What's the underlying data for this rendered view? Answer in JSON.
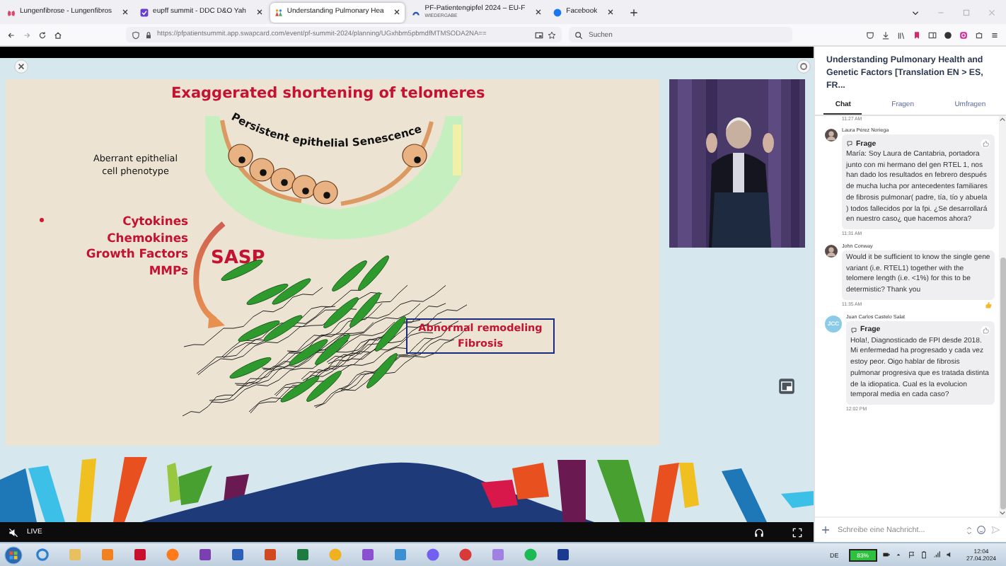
{
  "browser": {
    "tabs": [
      {
        "title": "Lungenfibrose - Lungenfibros",
        "selected": false,
        "kind": "lungs"
      },
      {
        "title": "eupff summit - DDC D&O Yah",
        "selected": false,
        "kind": "check"
      },
      {
        "title": "Understanding Pulmonary Hea",
        "selected": true,
        "kind": "people"
      },
      {
        "title": "PF-Patientengipfel 2024 – EU-F",
        "subtitle": "WIEDERGABE",
        "selected": false,
        "kind": "arc"
      },
      {
        "title": "Facebook",
        "selected": false,
        "kind": "circle"
      }
    ],
    "url": "https://pfpatientsummit.app.swapcard.com/event/pf-summit-2024/planning/UGxhbm5pbmdfMTMSODA2NA==",
    "search": {
      "placeholder": "Suchen"
    }
  },
  "slide": {
    "title": "Exaggerated shortening of telomeres",
    "curved_caption": "Persistent epithelial Senescence",
    "phenotype_label": [
      "Aberrant epithelial",
      "cell phenotype"
    ],
    "mediators": [
      "Cytokines",
      "Chemokines",
      "Growth Factors",
      "MMPs"
    ],
    "sasp_label": "SASP",
    "outcome_box": [
      "Abnormal remodeling",
      "Fibrosis"
    ]
  },
  "player": {
    "muted": true,
    "status": "LIVE"
  },
  "chat": {
    "title": "Understanding Pulmonary Health and Genetic Factors [Translation EN > ES, FR...",
    "tabs": [
      {
        "label": "Chat",
        "selected": true
      },
      {
        "label": "Fragen",
        "selected": false
      },
      {
        "label": "Umfragen",
        "selected": false
      }
    ],
    "items": [
      {
        "kind": "time",
        "time": "11:27 AM"
      },
      {
        "kind": "question",
        "author": "Laura Pérez Noriega",
        "label": "Frage",
        "text": "María: Soy Laura de Cantabria, portadora junto con mi hermano del gen RTEL 1, nos han dado los resultados en febrero después de mucha lucha por antecedentes familiares de fibrosis pulmonar( padre, tía, tío y abuela ) todos fallecidos por la fpi. ¿Se desarrollará en nuestro caso¿ que hacemos ahora?",
        "time": "11:31 AM",
        "reacted": false
      },
      {
        "kind": "message",
        "author": "John Conway",
        "text": "Would it be sufficient to know the single gene variant (i.e. RTEL1) together with the telomere length (i.e. <1%) for this to be determistic? Thank you",
        "time": "11:35 AM",
        "reacted": true
      },
      {
        "kind": "question",
        "author": "Juan Carlos Castelo Salat",
        "avatar": {
          "kind": "initials",
          "text": "JCC"
        },
        "label": "Frage",
        "text": "Hola!, Diagnosticado de FPI desde 2018. Mi enfermedad ha progresado y cada vez estoy peor. Oigo hablar de fibrosis pulmonar progresiva que es tratada distinta de la idiopatica. Cual es la evolucion temporal media en cada caso?",
        "time": "12:02 PM",
        "reacted": false
      }
    ],
    "input": {
      "placeholder": "Schreibe eine Nachricht..."
    }
  },
  "taskbar": {
    "language": "DE",
    "battery_reading": "83%",
    "time": "12:04",
    "date": "27.04.2024"
  }
}
